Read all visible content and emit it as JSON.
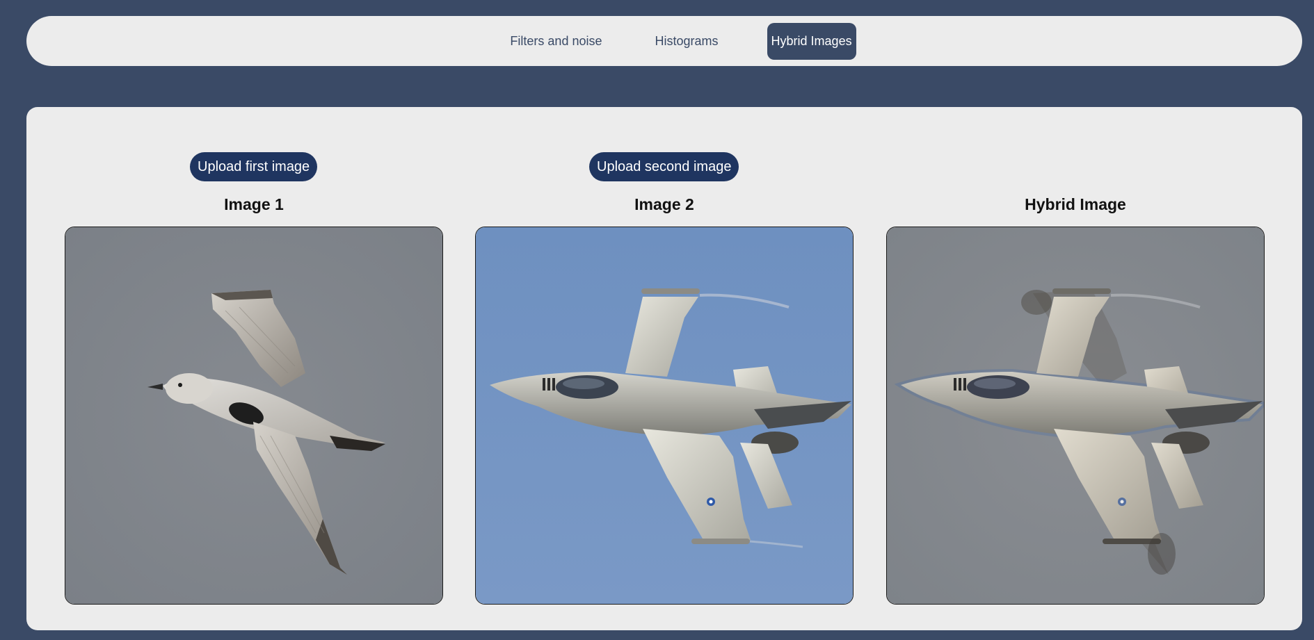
{
  "nav": {
    "items": [
      {
        "label": "Filters and noise",
        "active": false
      },
      {
        "label": "Histograms",
        "active": false
      },
      {
        "label": "Hybrid Images",
        "active": true
      }
    ]
  },
  "upload": {
    "first_label": "Upload first image",
    "second_label": "Upload second image"
  },
  "columns": {
    "image1_title": "Image 1",
    "image2_title": "Image 2",
    "hybrid_title": "Hybrid Image"
  },
  "colors": {
    "page_bg": "#3a4a66",
    "panel_bg": "#ececec",
    "button_bg": "#1f3560",
    "image1_bg": "#7e838a",
    "image2_bg": "#7293c2",
    "hybrid_bg": "#80858b"
  }
}
